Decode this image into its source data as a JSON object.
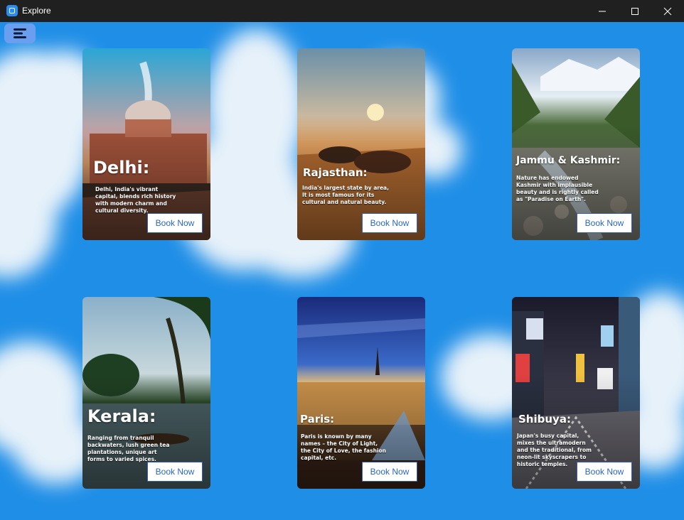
{
  "window": {
    "title": "Explore",
    "colors": {
      "titlebar": "#202020",
      "background": "#1f8ee6",
      "menu_button": "#6a9ff0",
      "button_text": "#2a66c4"
    }
  },
  "toolbar": {
    "menu_icon": "hamburger-menu-icon"
  },
  "destinations": [
    {
      "title": "Delhi:",
      "description": "Delhi, India's vibrant capital, blends rich history with modern charm and cultural diversity.",
      "button_label": "Book Now"
    },
    {
      "title": "Rajasthan:",
      "description": "India's largest state by area, It is most famous for its cultural and natural beauty.",
      "button_label": "Book Now"
    },
    {
      "title": "Jammu & Kashmir:",
      "description": "Nature has endowed Kashmir with implausible beauty and is rightly called as \"Paradise on Earth\".",
      "button_label": "Book Now"
    },
    {
      "title": "Kerala:",
      "description": "Ranging from tranquil backwaters, lush green tea plantations, unique art forms to varied spices.",
      "button_label": "Book Now"
    },
    {
      "title": "Paris:",
      "description": "Paris is known by many names – the City of Light, the City of Love, the fashion capital, etc.",
      "button_label": "Book Now"
    },
    {
      "title": "Shibuya:",
      "description": "Japan's busy capital, mixes the ultramodern and the traditional, from neon-lit skyscrapers to historic temples.",
      "button_label": "Book Now"
    }
  ]
}
